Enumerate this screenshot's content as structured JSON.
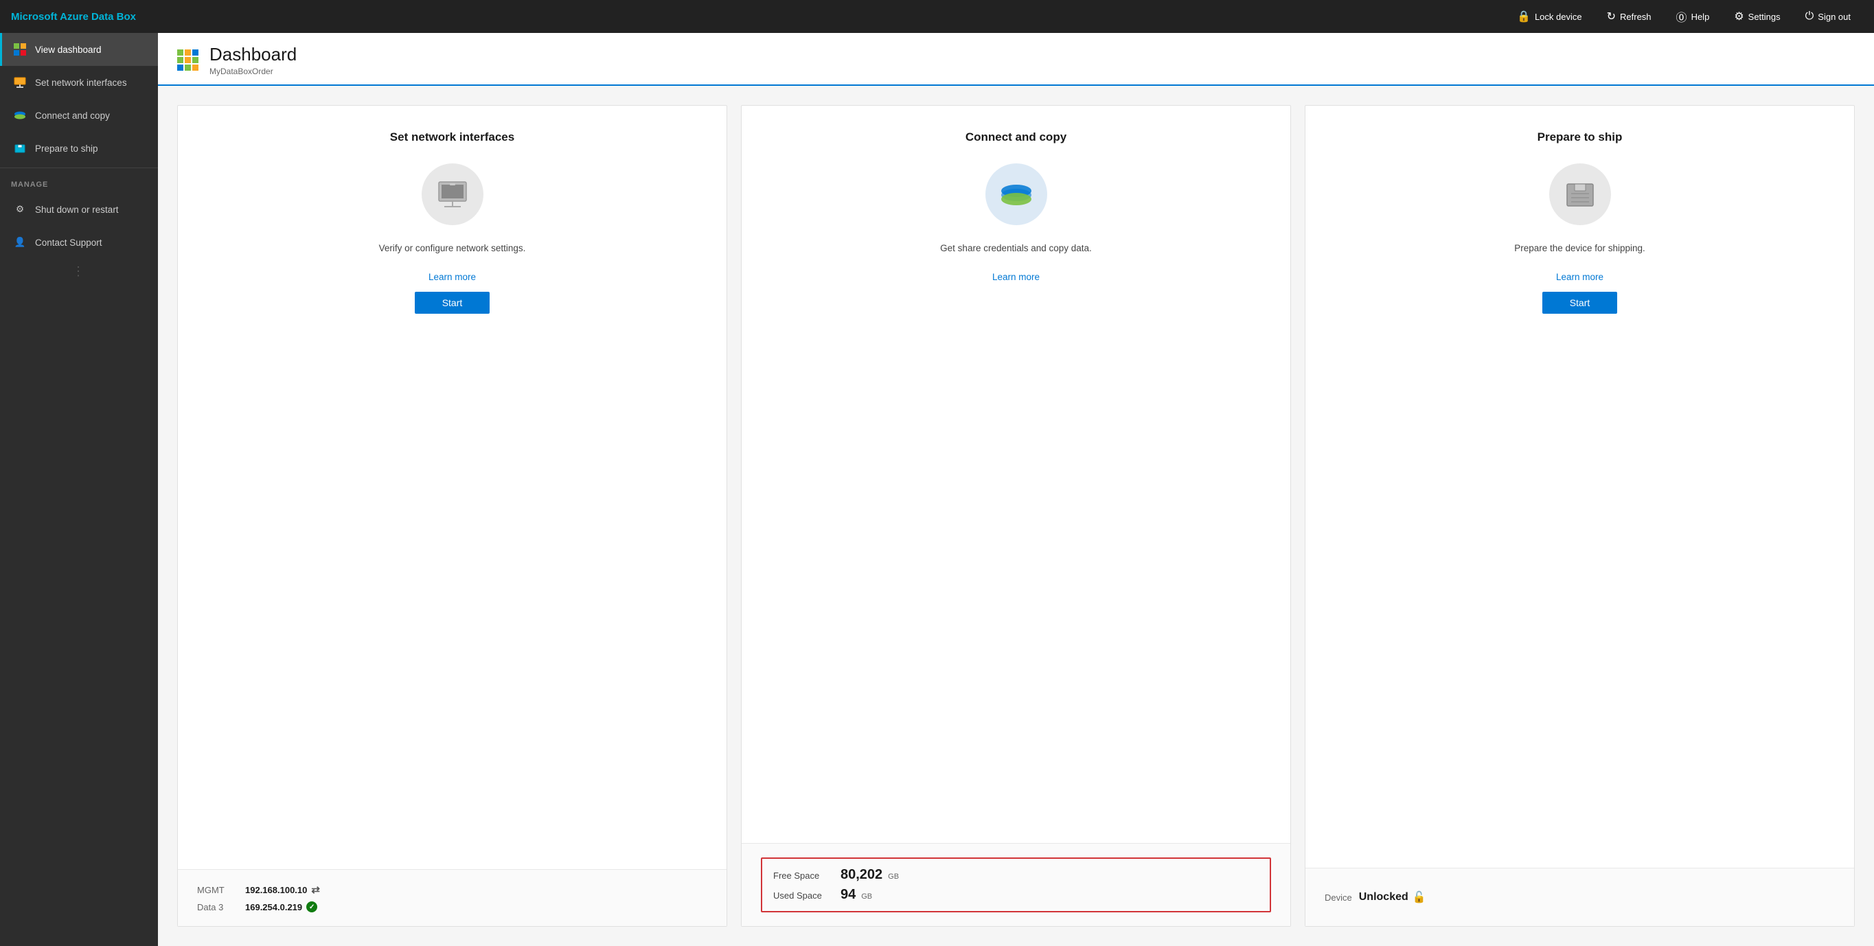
{
  "app": {
    "title": "Microsoft Azure Data Box"
  },
  "topbar": {
    "lock_label": "Lock device",
    "refresh_label": "Refresh",
    "help_label": "Help",
    "settings_label": "Settings",
    "signout_label": "Sign out"
  },
  "sidebar": {
    "items": [
      {
        "id": "view-dashboard",
        "label": "View dashboard",
        "active": true
      },
      {
        "id": "set-network-interfaces",
        "label": "Set network interfaces",
        "active": false
      },
      {
        "id": "connect-and-copy",
        "label": "Connect and copy",
        "active": false
      },
      {
        "id": "prepare-to-ship",
        "label": "Prepare to ship",
        "active": false
      }
    ],
    "manage_label": "MANAGE",
    "manage_items": [
      {
        "id": "shut-down-restart",
        "label": "Shut down or restart"
      },
      {
        "id": "contact-support",
        "label": "Contact Support"
      }
    ]
  },
  "page": {
    "title": "Dashboard",
    "subtitle": "MyDataBoxOrder"
  },
  "cards": [
    {
      "id": "set-network-card",
      "title": "Set network interfaces",
      "description": "Verify or configure network settings.",
      "learn_more_label": "Learn more",
      "start_label": "Start",
      "bottom": {
        "rows": [
          {
            "label": "MGMT",
            "value": "192.168.100.10",
            "has_arrows": true,
            "has_check": false
          },
          {
            "label": "Data 3",
            "value": "169.254.0.219",
            "has_arrows": false,
            "has_check": true
          }
        ]
      }
    },
    {
      "id": "connect-copy-card",
      "title": "Connect and copy",
      "description": "Get share credentials and copy data.",
      "learn_more_label": "Learn more",
      "start_label": null,
      "bottom": {
        "free_space_label": "Free Space",
        "free_space_value": "80,202",
        "free_space_unit": "GB",
        "used_space_label": "Used Space",
        "used_space_value": "94",
        "used_space_unit": "GB"
      }
    },
    {
      "id": "prepare-ship-card",
      "title": "Prepare to ship",
      "description": "Prepare the device for shipping.",
      "learn_more_label": "Learn more",
      "start_label": "Start",
      "bottom": {
        "device_label": "Device",
        "device_value": "Unlocked"
      }
    }
  ]
}
